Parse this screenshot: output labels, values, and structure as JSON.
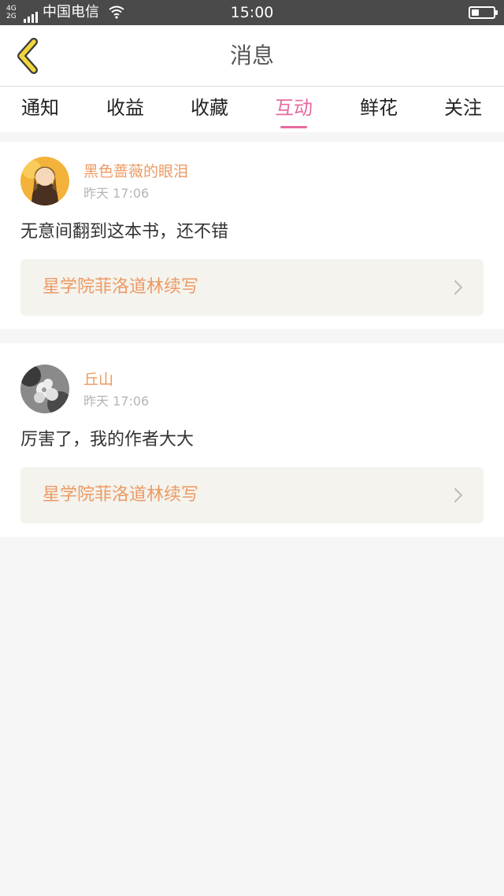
{
  "status_bar": {
    "network_top": "4G",
    "network_bottom": "2G",
    "carrier": "中国电信",
    "time": "15:00",
    "battery_level": 0.35
  },
  "nav": {
    "back_icon": "chevron-left-icon",
    "title": "消息",
    "accent_color": "#f0d53c"
  },
  "tabs": [
    {
      "label": "通知",
      "active": false
    },
    {
      "label": "收益",
      "active": false
    },
    {
      "label": "收藏",
      "active": false
    },
    {
      "label": "互动",
      "active": true
    },
    {
      "label": "鲜花",
      "active": false
    },
    {
      "label": "关注",
      "active": false
    }
  ],
  "colors": {
    "active_tab": "#e86aa0",
    "username": "#ec9a63",
    "book_link_bg": "#f4f3ed"
  },
  "messages": [
    {
      "username": "黑色蔷薇的眼泪",
      "time": "昨天 17:06",
      "comment": "无意间翻到这本书，还不错",
      "book": "星学院菲洛道林续写"
    },
    {
      "username": "丘山",
      "time": "昨天 17:06",
      "comment": "厉害了，我的作者大大",
      "book": "星学院菲洛道林续写"
    }
  ]
}
